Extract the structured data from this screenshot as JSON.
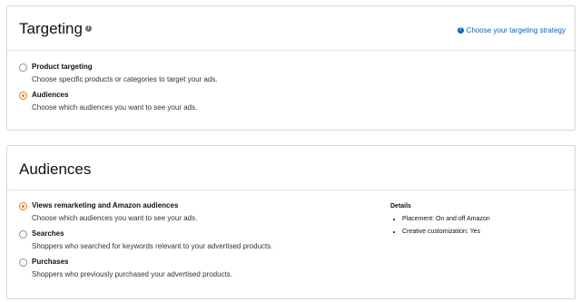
{
  "targeting": {
    "title": "Targeting",
    "info_icon": "i",
    "strategy_link": "Choose your targeting strategy",
    "strategy_icon": "?",
    "options": [
      {
        "label": "Product targeting",
        "description": "Choose specific products or categories to target your ads.",
        "checked": false
      },
      {
        "label": "Audiences",
        "description": "Choose which audiences you want to see your ads.",
        "checked": true
      }
    ]
  },
  "audiences": {
    "title": "Audiences",
    "options": [
      {
        "label": "Views remarketing and Amazon audiences",
        "description": "Choose which audiences you want to see your ads.",
        "checked": true
      },
      {
        "label": "Searches",
        "description": "Shoppers who searched for keywords relevant to your advertised products.",
        "checked": false
      },
      {
        "label": "Purchases",
        "description": "Shoppers who previously purchased your advertised products.",
        "checked": false
      }
    ],
    "details": {
      "title": "Details",
      "items": [
        "Placement: On and off Amazon",
        "Creative customization: Yes"
      ]
    }
  },
  "colors": {
    "accent": "#e47911",
    "link": "#0066c0",
    "border": "#d5d9d9"
  }
}
